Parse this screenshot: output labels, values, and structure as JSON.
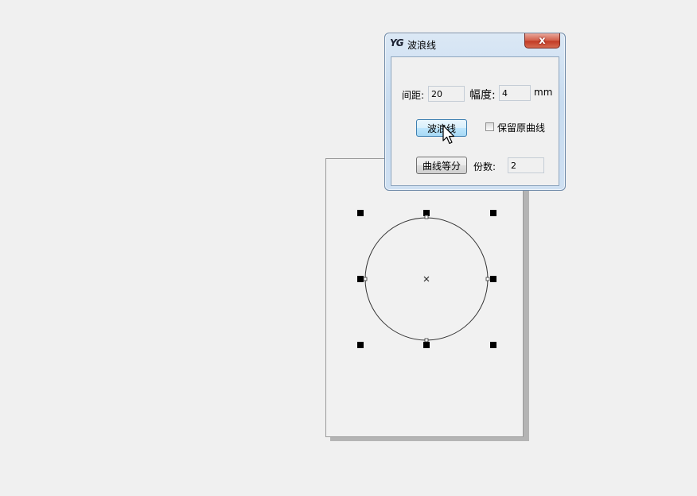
{
  "dialog": {
    "logo": "YG",
    "title": "波浪线",
    "close_label": "x",
    "spacing_label": "间距:",
    "spacing_value": "20",
    "amplitude_label": "幅度:",
    "amplitude_value": "4",
    "unit": "mm",
    "wave_button": "波浪线",
    "keep_curve_label": "保留原曲线",
    "keep_curve_checked": false,
    "divide_button": "曲线等分",
    "parts_label": "份数:",
    "parts_value": "2"
  },
  "icons": {
    "cursor": "arrow-pointer-icon",
    "center": "center-x-icon"
  }
}
